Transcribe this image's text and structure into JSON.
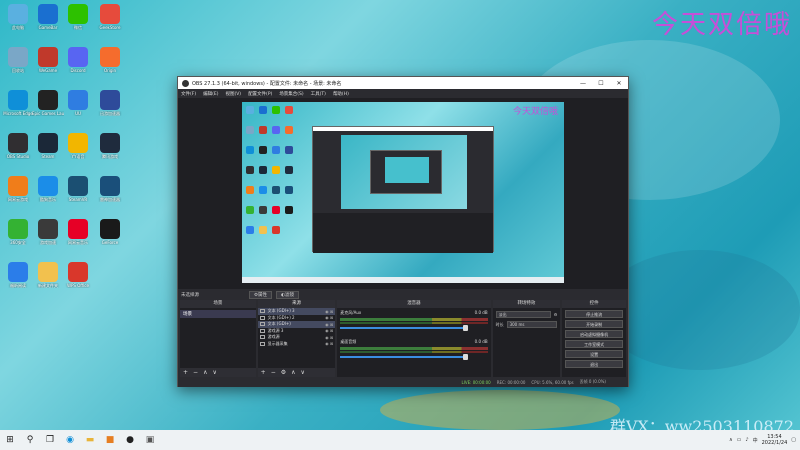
{
  "desktop": {
    "watermark_top": "今天双倍哦",
    "watermark_bottom": "群VX：ww2503110872",
    "icons": [
      {
        "label": "此电脑",
        "icon": "computer-icon",
        "color": "#5ab0e0"
      },
      {
        "label": "GameBar",
        "icon": "gamebar-icon",
        "color": "#1a6fd0"
      },
      {
        "label": "微信",
        "icon": "wechat-icon",
        "color": "#2dc100"
      },
      {
        "label": "GeekStore",
        "icon": "game-store-icon",
        "color": "#e64b3c"
      },
      {
        "label": "回收站",
        "icon": "recycle-bin-icon",
        "color": "#7aa7c7"
      },
      {
        "label": "WeGame",
        "icon": "wegame-icon",
        "color": "#c0392b"
      },
      {
        "label": "Discord",
        "icon": "discord-icon",
        "color": "#5865f2"
      },
      {
        "label": "Origin",
        "icon": "origin-icon",
        "color": "#f56c2d"
      },
      {
        "label": "Microsoft Edge",
        "icon": "edge-icon",
        "color": "#0f8fd8"
      },
      {
        "label": "Epic Games Launcher",
        "icon": "epic-icon",
        "color": "#222222"
      },
      {
        "label": "UU",
        "icon": "uu-booster-icon",
        "color": "#2f7de1"
      },
      {
        "label": "迅游加速器",
        "icon": "xunyou-icon",
        "color": "#2e4b9a"
      },
      {
        "label": "OBS Studio",
        "icon": "obs-icon",
        "color": "#302e31"
      },
      {
        "label": "Steam",
        "icon": "steam-icon",
        "color": "#1b2838"
      },
      {
        "label": "YY语音",
        "icon": "yy-icon",
        "color": "#f2b600"
      },
      {
        "label": "腾讯游戏",
        "icon": "tencent-games-icon",
        "color": "#1f2b3d"
      },
      {
        "label": "网易云游戏",
        "icon": "netease-game-icon",
        "color": "#f07d1a"
      },
      {
        "label": "酷狗音乐",
        "icon": "kugou-icon",
        "color": "#1b8de8"
      },
      {
        "label": "SteamVR",
        "icon": "steamvr-icon",
        "color": "#1b4f72"
      },
      {
        "label": "雷神加速器",
        "icon": "leishen-icon",
        "color": "#1a4f7a"
      },
      {
        "label": "360安全",
        "icon": "360-icon",
        "color": "#34b233"
      },
      {
        "label": "游戏加速",
        "icon": "game-boost-icon",
        "color": "#3a3a3a"
      },
      {
        "label": "网易云音乐",
        "icon": "netease-music-icon",
        "color": "#e60026"
      },
      {
        "label": "GeForce",
        "icon": "geforce-icon",
        "color": "#1a1a1a"
      },
      {
        "label": "福昕阅读",
        "icon": "reader-icon",
        "color": "#2b7de9"
      },
      {
        "label": "新建文件夹",
        "icon": "folder-icon",
        "color": "#f2c14e"
      },
      {
        "label": "WPS Office",
        "icon": "wps-icon",
        "color": "#d9372b"
      }
    ]
  },
  "obs": {
    "title": "OBS 27.1.3 (64-bit, windows) - 配置文件: 未命名 - 场景: 未命名",
    "window_controls": {
      "minimize": "—",
      "maximize": "☐",
      "close": "✕"
    },
    "menu": [
      "文件(F)",
      "编辑(E)",
      "视图(V)",
      "配置文件(P)",
      "场景集合(S)",
      "工具(T)",
      "帮助(H)"
    ],
    "scene_bar": {
      "no_source": "未选择源",
      "properties": "⚙属性",
      "filters": "◐滤镜"
    },
    "docks": {
      "scenes": {
        "header": "场景",
        "items": [
          "场景"
        ]
      },
      "sources": {
        "header": "来源",
        "items": [
          {
            "label": "文本 (GDI+) 3",
            "selected": true
          },
          {
            "label": "文本 (GDI+) 2",
            "selected": false
          },
          {
            "label": "文本 (GDI+)",
            "selected": true
          },
          {
            "label": "游戏源 3",
            "selected": false
          },
          {
            "label": "游戏源",
            "selected": false
          },
          {
            "label": "显示器采集",
            "selected": false
          }
        ]
      },
      "mixer": {
        "header": "混音器",
        "channels": [
          {
            "name": "麦克风/Aux",
            "db": "0.0 dB"
          },
          {
            "name": "桌面音频",
            "db": "0.0 dB"
          }
        ]
      },
      "transitions": {
        "header": "转场特效",
        "type": "淡出",
        "duration_label": "时长",
        "duration": "300 ms"
      },
      "controls": {
        "header": "控件",
        "buttons": [
          "停止推流",
          "开始录制",
          "启动虚拟摄像机",
          "工作室模式",
          "设置",
          "退出"
        ]
      }
    },
    "statusbar": {
      "live": "LIVE: 00:00:00",
      "rec": "REC: 00:00:00",
      "cpu": "CPU: 5.6%, 60.00 fps",
      "frames": "丢帧 0 (0.0%)"
    }
  },
  "taskbar": {
    "icons": [
      "windows-start-icon",
      "search-icon",
      "task-view-icon",
      "edge-icon",
      "file-explorer-icon",
      "store-icon",
      "obs-icon",
      "media-icon"
    ],
    "time": "13:54",
    "date": "2022/1/24"
  }
}
